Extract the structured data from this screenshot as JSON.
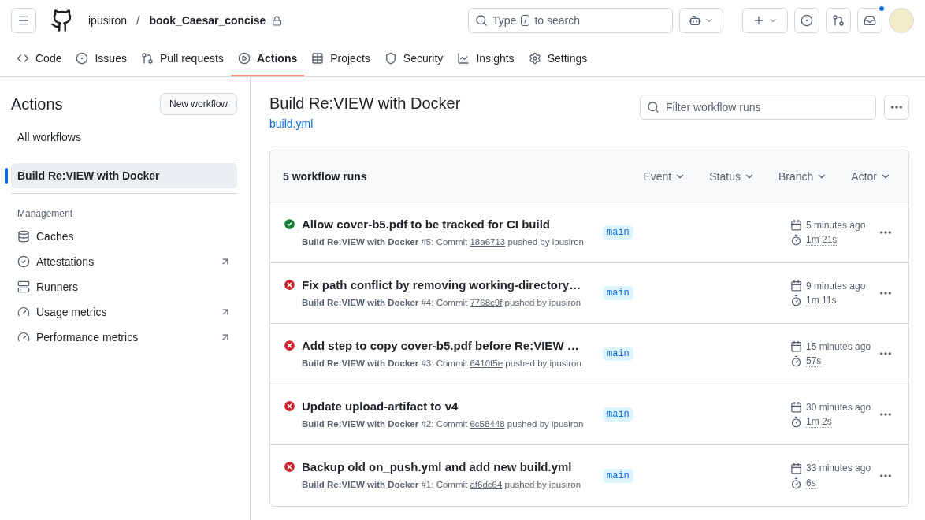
{
  "header": {
    "owner": "ipusiron",
    "separator": "/",
    "repo": "book_Caesar_concise",
    "search": {
      "placeholder_before": "Type",
      "key": "/",
      "placeholder_after": "to search"
    },
    "notification_unread": true
  },
  "tabs": [
    {
      "label": "Code",
      "selected": false
    },
    {
      "label": "Issues",
      "selected": false
    },
    {
      "label": "Pull requests",
      "selected": false
    },
    {
      "label": "Actions",
      "selected": true
    },
    {
      "label": "Projects",
      "selected": false
    },
    {
      "label": "Security",
      "selected": false
    },
    {
      "label": "Insights",
      "selected": false
    },
    {
      "label": "Settings",
      "selected": false
    }
  ],
  "sidebar": {
    "title": "Actions",
    "new_button": "New workflow",
    "all": "All workflows",
    "workflows": [
      {
        "label": "Build Re:VIEW with Docker",
        "selected": true
      }
    ],
    "section": "Management",
    "items": [
      {
        "label": "Caches",
        "external": false
      },
      {
        "label": "Attestations",
        "external": true
      },
      {
        "label": "Runners",
        "external": false
      },
      {
        "label": "Usage metrics",
        "external": true
      },
      {
        "label": "Performance metrics",
        "external": true
      }
    ]
  },
  "main": {
    "title": "Build Re:VIEW with Docker",
    "file": "build.yml",
    "filter_placeholder": "Filter workflow runs",
    "count": "5 workflow runs",
    "filters": [
      "Event",
      "Status",
      "Branch",
      "Actor"
    ],
    "runs": [
      {
        "title": "Allow cover-b5.pdf to be tracked for CI build",
        "kind": "success",
        "workflow": "Build Re:VIEW with Docker",
        "number": "#5: Commit",
        "commit": "18a6713",
        "pushed": "pushed by ipusiron",
        "branch": "main",
        "time": "5 minutes ago",
        "duration": "1m 21s"
      },
      {
        "title": "Fix path conflict by removing working-directory…",
        "kind": "failure",
        "workflow": "Build Re:VIEW with Docker",
        "number": "#4: Commit",
        "commit": "7768c9f",
        "pushed": "pushed by ipusiron",
        "branch": "main",
        "time": "9 minutes ago",
        "duration": "1m 11s"
      },
      {
        "title": "Add step to copy cover-b5.pdf before Re:VIEW …",
        "kind": "failure",
        "workflow": "Build Re:VIEW with Docker",
        "number": "#3: Commit",
        "commit": "6410f5e",
        "pushed": "pushed by ipusiron",
        "branch": "main",
        "time": "15 minutes ago",
        "duration": "57s"
      },
      {
        "title": "Update upload-artifact to v4",
        "kind": "failure",
        "workflow": "Build Re:VIEW with Docker",
        "number": "#2: Commit",
        "commit": "6c58448",
        "pushed": "pushed by ipusiron",
        "branch": "main",
        "time": "30 minutes ago",
        "duration": "1m 2s"
      },
      {
        "title": "Backup old on_push.yml and add new build.yml",
        "kind": "failure",
        "workflow": "Build Re:VIEW with Docker",
        "number": "#1: Commit",
        "commit": "af6dc64",
        "pushed": "pushed by ipusiron",
        "branch": "main",
        "time": "33 minutes ago",
        "duration": "6s"
      }
    ]
  }
}
